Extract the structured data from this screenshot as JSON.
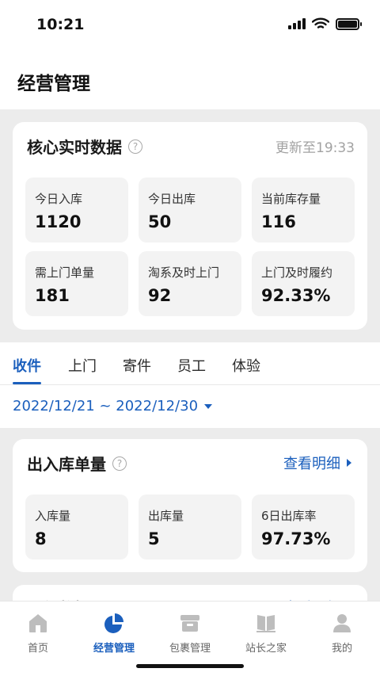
{
  "status_bar": {
    "time": "10:21"
  },
  "header": {
    "title": "经营管理"
  },
  "core_card": {
    "title": "核心实时数据",
    "updated": "更新至19:33",
    "stats": [
      {
        "label": "今日入库",
        "value": "1120"
      },
      {
        "label": "今日出库",
        "value": "50"
      },
      {
        "label": "当前库存量",
        "value": "116"
      },
      {
        "label": "需上门单量",
        "value": "181"
      },
      {
        "label": "淘系及时上门",
        "value": "92"
      },
      {
        "label": "上门及时履约",
        "value": "92.33%"
      }
    ]
  },
  "tabs": [
    {
      "label": "收件",
      "active": true
    },
    {
      "label": "上门"
    },
    {
      "label": "寄件"
    },
    {
      "label": "员工"
    },
    {
      "label": "体验"
    }
  ],
  "date_range": "2022/12/21 ~ 2022/12/30",
  "inout_card": {
    "title": "出入库单量",
    "link": "查看明细",
    "stats": [
      {
        "label": "入库量",
        "value": "8"
      },
      {
        "label": "出库量",
        "value": "5"
      },
      {
        "label": "6日出库率",
        "value": "97.73%"
      }
    ]
  },
  "pickup_card": {
    "title": "取件数据",
    "link": "查看明细"
  },
  "tab_bar": [
    {
      "label": "首页",
      "icon": "home-icon"
    },
    {
      "label": "经营管理",
      "icon": "pie-chart-icon",
      "active": true
    },
    {
      "label": "包裹管理",
      "icon": "package-box-icon"
    },
    {
      "label": "站长之家",
      "icon": "book-icon"
    },
    {
      "label": "我的",
      "icon": "user-profile-icon"
    }
  ],
  "colors": {
    "accent": "#1b5fbd",
    "background": "#ececec",
    "card": "#ffffff",
    "tile": "#f3f3f3"
  }
}
